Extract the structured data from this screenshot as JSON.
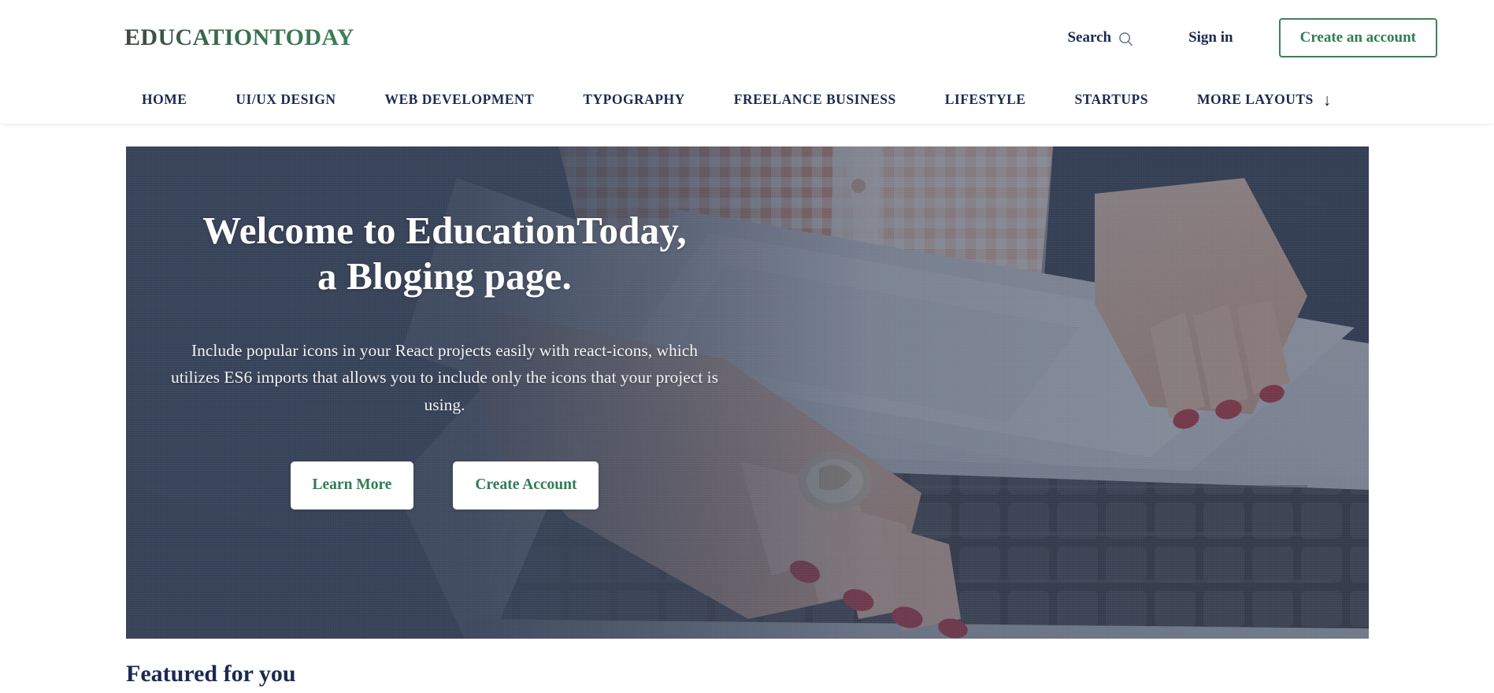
{
  "header": {
    "logo": "EDUCATIONTODAY",
    "search_label": "Search",
    "search_icon": "search-icon",
    "signin_label": "Sign in",
    "create_account_label": "Create an account",
    "accent_green": "#3c8159",
    "navy": "#1b2a52"
  },
  "nav": {
    "items": [
      {
        "label": "HOME"
      },
      {
        "label": "UI/UX DESIGN"
      },
      {
        "label": "WEB DEVELOPMENT"
      },
      {
        "label": "TYPOGRAPHY"
      },
      {
        "label": "FREELANCE BUSINESS"
      },
      {
        "label": "LIFESTYLE"
      },
      {
        "label": "STARTUPS"
      }
    ],
    "more_label": "MORE LAYOUTS",
    "more_icon": "arrow-down-icon",
    "more_icon_glyph": "↓"
  },
  "hero": {
    "title_line1": "Welcome to EducationToday,",
    "title_line2": "a Bloging page.",
    "subtitle": "Include popular icons in your React projects easily with react-icons, which utilizes ES6 imports that allows you to include only the icons that your project is using.",
    "primary_button": "Learn More",
    "secondary_button": "Create Account",
    "background_image_alt": "hands-typing-on-laptop-photo",
    "overlay_color": "#374258"
  },
  "below_hero": {
    "section_heading": "Featured for you"
  }
}
